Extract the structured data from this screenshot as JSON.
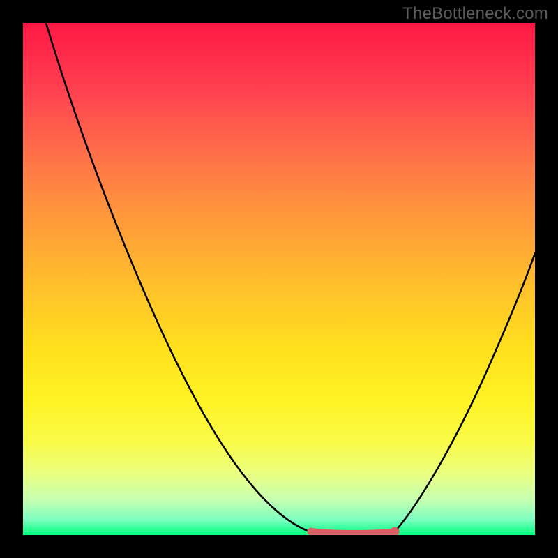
{
  "watermark": "TheBottleneck.com",
  "colors": {
    "curve": "#000000",
    "highlight": "#d96065",
    "bg_top": "#ff1946",
    "bg_bottom": "#00ff7c",
    "frame": "#000000"
  },
  "chart_data": {
    "type": "line",
    "title": "",
    "xlabel": "",
    "ylabel": "",
    "xlim": [
      0,
      100
    ],
    "ylim": [
      0,
      100
    ],
    "series": [
      {
        "name": "bottleneck_curve",
        "x": [
          4.5,
          12,
          20,
          28,
          36,
          44,
          50,
          55,
          56.5,
          60,
          65,
          71,
          72.5,
          78,
          85,
          92,
          100
        ],
        "values": [
          100,
          85,
          68,
          52,
          37,
          22,
          10,
          2,
          0.5,
          0,
          0,
          0.5,
          1,
          8,
          22,
          40,
          55
        ]
      }
    ],
    "annotations": [
      {
        "name": "optimal_range_highlight",
        "x_start": 56,
        "x_end": 72.5,
        "color": "#d96065"
      }
    ],
    "background_gradient": {
      "direction": "vertical",
      "stops": [
        {
          "pos": 0.0,
          "color": "#ff1946"
        },
        {
          "pos": 0.5,
          "color": "#ffc728"
        },
        {
          "pos": 0.85,
          "color": "#f9fb49"
        },
        {
          "pos": 1.0,
          "color": "#00ff7c"
        }
      ]
    }
  }
}
